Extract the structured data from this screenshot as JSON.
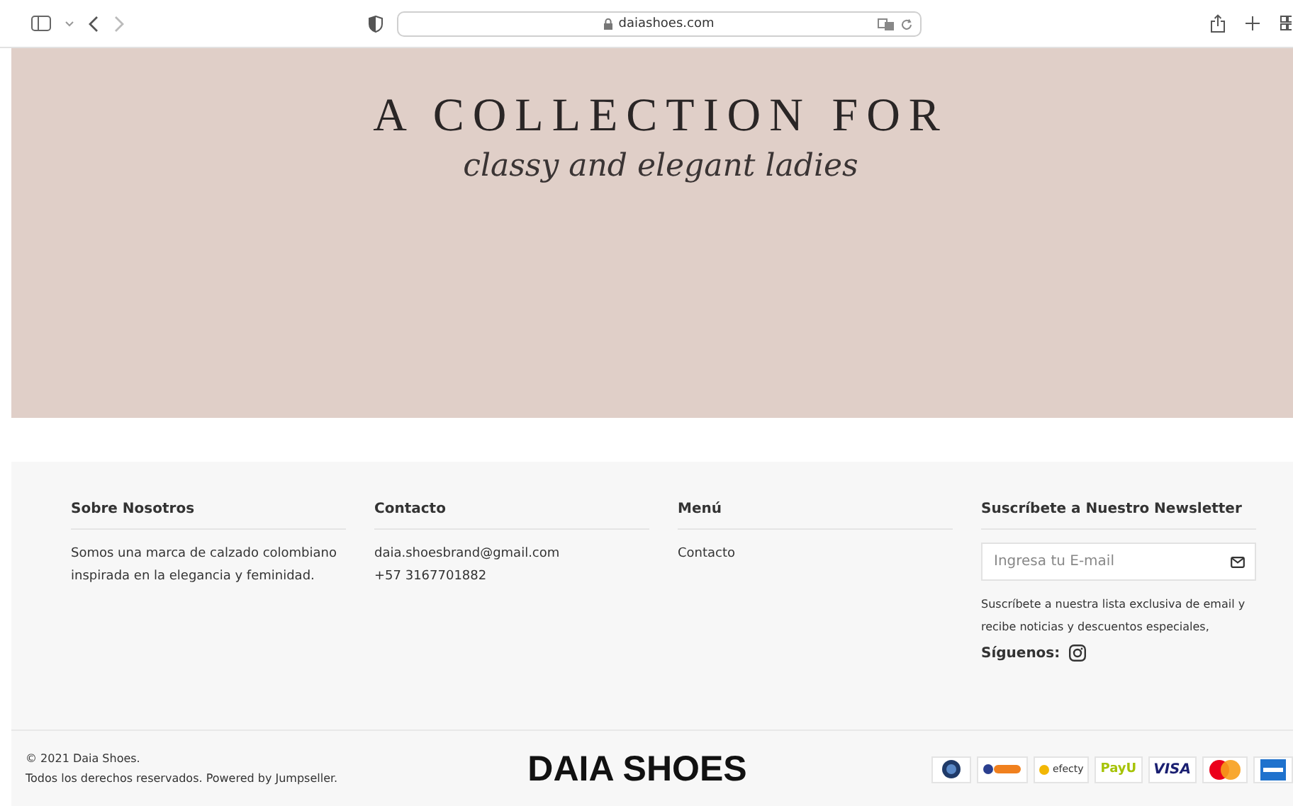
{
  "browser": {
    "url": "daiashoes.com"
  },
  "hero": {
    "title": "A COLLECTION FOR",
    "subtitle": "classy and elegant ladies"
  },
  "footer": {
    "columns": [
      {
        "kind": "text",
        "heading": "Sobre Nosotros",
        "lines": [
          "Somos una marca de calzado colombiano inspirada en la elegancia y feminidad."
        ]
      },
      {
        "kind": "text",
        "heading": "Contacto",
        "lines": [
          "daia.shoesbrand@gmail.com",
          "+57 3167701882"
        ]
      },
      {
        "kind": "links",
        "heading": "Menú",
        "lines": [
          "Contacto"
        ]
      },
      {
        "kind": "newsletter",
        "heading": "Suscríbete a Nuestro Newsletter",
        "placeholder": "Ingresa tu E-mail",
        "note": "Suscríbete a nuestra lista exclusiva de email y recibe noticias y descuentos especiales,",
        "follow": "Síguenos:"
      }
    ],
    "copyright": [
      "© 2021 Daia Shoes.",
      "Todos los derechos reservados. Powered by Jumpseller."
    ],
    "brand": "DAIA SHOES",
    "payments": [
      {
        "kind": "pse"
      },
      {
        "kind": "baloto"
      },
      {
        "kind": "efecty",
        "label": "efecty"
      },
      {
        "kind": "payu",
        "label": "PayU"
      },
      {
        "kind": "visa",
        "label": "VISA"
      },
      {
        "kind": "mastercard"
      },
      {
        "kind": "amex"
      }
    ]
  }
}
